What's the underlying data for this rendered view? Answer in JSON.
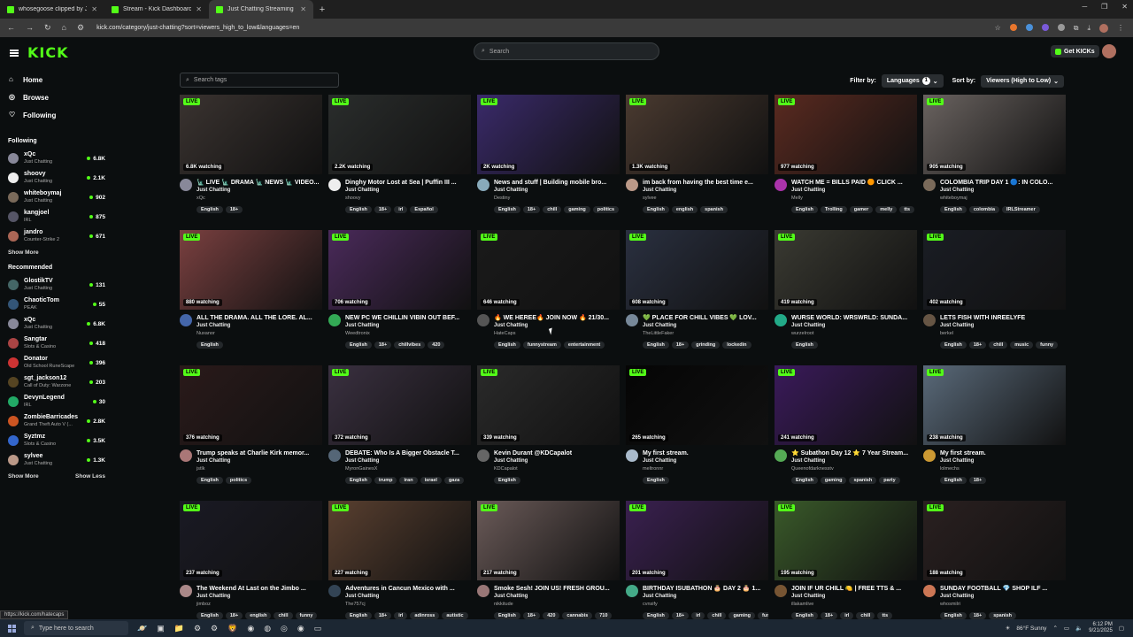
{
  "browser": {
    "tabs": [
      {
        "title": "whosegoose clipped by JagerR"
      },
      {
        "title": "Stream - Kick Dashboard"
      },
      {
        "title": "Just Chatting Streaming - Live"
      }
    ],
    "url": "kick.com/category/just-chatting?sort=viewers_high_to_low&languages=en",
    "status_url": "https://kick.com/hatecaps"
  },
  "app": {
    "logo": "KICK",
    "search_placeholder": "Search",
    "get_kicks": "Get KICKs",
    "accent": "#53fc18"
  },
  "sidebar": {
    "nav": [
      {
        "label": "Home",
        "icon": "home-icon"
      },
      {
        "label": "Browse",
        "icon": "compass-icon"
      },
      {
        "label": "Following",
        "icon": "heart-icon"
      }
    ],
    "following_title": "Following",
    "following": [
      {
        "name": "xQc",
        "category": "Just Chatting",
        "viewers": "6.8K",
        "color": "#889"
      },
      {
        "name": "shoovy",
        "category": "Just Chatting",
        "viewers": "2.1K",
        "color": "#eee"
      },
      {
        "name": "whiteboymaj",
        "category": "Just Chatting",
        "viewers": "902",
        "color": "#7a6a5a"
      },
      {
        "name": "kangjoel",
        "category": "IRL",
        "viewers": "875",
        "color": "#556"
      },
      {
        "name": "jandro",
        "category": "Counter-Strike 2",
        "viewers": "671",
        "color": "#a65"
      }
    ],
    "show_more_1": "Show More",
    "recommended_title": "Recommended",
    "recommended": [
      {
        "name": "GlostikTV",
        "category": "Just Chatting",
        "viewers": "131",
        "color": "#466"
      },
      {
        "name": "ChaoticTom",
        "category": "PEAK",
        "viewers": "55",
        "color": "#357"
      },
      {
        "name": "xQc",
        "category": "Just Chatting",
        "viewers": "6.8K",
        "color": "#889"
      },
      {
        "name": "Sangtar",
        "category": "Slots & Casino",
        "viewers": "418",
        "color": "#a44"
      },
      {
        "name": "Donator",
        "category": "Old School RuneScape",
        "viewers": "396",
        "color": "#c33"
      },
      {
        "name": "sgt_jackson12",
        "category": "Call of Duty: Warzone",
        "viewers": "203",
        "color": "#542"
      },
      {
        "name": "DevynLegend",
        "category": "IRL",
        "viewers": "30",
        "color": "#2a6"
      },
      {
        "name": "ZombieBarricades",
        "category": "Grand Theft Auto V (...",
        "viewers": "2.8K",
        "color": "#c52"
      },
      {
        "name": "Syztmz",
        "category": "Slots & Casino",
        "viewers": "3.5K",
        "color": "#36c"
      },
      {
        "name": "sylvee",
        "category": "Just Chatting",
        "viewers": "1.3K",
        "color": "#b98"
      }
    ],
    "show_more_2": "Show More",
    "show_less": "Show Less"
  },
  "filters": {
    "tag_search_placeholder": "Search tags",
    "filter_label": "Filter by:",
    "languages_label": "Languages",
    "languages_count": "1",
    "sort_label": "Sort by:",
    "sort_value": "Viewers (High to Low)"
  },
  "streams": [
    {
      "title": "🗽 LIVE 🗽 DRAMA 🗽 NEWS 🗽 VIDEO...",
      "category": "Just Chatting",
      "user": "xQc",
      "viewers": "6.8K watching",
      "tags": [
        "English",
        "18+"
      ],
      "thumb": "#3a3330",
      "avatar": "#889"
    },
    {
      "title": "Dinghy Motor Lost at Sea | Puffin III ...",
      "category": "Just Chatting",
      "user": "shoovy",
      "viewers": "2.2K watching",
      "tags": [
        "English",
        "18+",
        "irl",
        "Español"
      ],
      "thumb": "#2a2d2c",
      "avatar": "#eee"
    },
    {
      "title": "News and stuff | Building mobile bro...",
      "category": "Just Chatting",
      "user": "Destiny",
      "viewers": "2K watching",
      "tags": [
        "English",
        "18+",
        "chill",
        "gaming",
        "politics"
      ],
      "thumb": "#3a2a6a",
      "avatar": "#8ab"
    },
    {
      "title": "im back from having the best time e...",
      "category": "Just Chatting",
      "user": "sylvee",
      "viewers": "1.3K watching",
      "tags": [
        "English",
        "english",
        "spanish"
      ],
      "thumb": "#4a3a30",
      "avatar": "#b98"
    },
    {
      "title": "WATCH ME = BILLS PAID 🟠 CLICK ...",
      "category": "Just Chatting",
      "user": "Melly",
      "viewers": "977 watching",
      "tags": [
        "English",
        "Trolling",
        "gamer",
        "melly",
        "tts"
      ],
      "thumb": "#5a2a20",
      "avatar": "#a3a"
    },
    {
      "title": "COLOMBIA TRIP DAY 1 🔵: IN COLO...",
      "category": "Just Chatting",
      "user": "whiteboymaj",
      "viewers": "905 watching",
      "tags": [
        "English",
        "colombia",
        "IRLStreamer"
      ],
      "thumb": "#6a6360",
      "avatar": "#7a6a5a"
    },
    {
      "title": "ALL THE DRAMA. ALL THE LORE. AL...",
      "category": "Just Chatting",
      "user": "Nuxanor",
      "viewers": "880 watching",
      "tags": [
        "English"
      ],
      "thumb": "#7a4040",
      "avatar": "#46a"
    },
    {
      "title": "NEW PC WE CHILLIN VIBIN OUT BEF...",
      "category": "Just Chatting",
      "user": "Weedtronix",
      "viewers": "706 watching",
      "tags": [
        "English",
        "18+",
        "chillvibes",
        "420"
      ],
      "thumb": "#4a2a5a",
      "avatar": "#3a5"
    },
    {
      "title": "🔥 WE HEREE🔥 JOIN NOW 🔥 21/30...",
      "category": "Just Chatting",
      "user": "HateCaps",
      "viewers": "646 watching",
      "tags": [
        "English",
        "funnystream",
        "entertainment"
      ],
      "thumb": "#1a1a1a",
      "avatar": "#555"
    },
    {
      "title": "💚 PLACE FOR CHILL VIBES 💚 LOV...",
      "category": "Just Chatting",
      "user": "TheLittleFaker",
      "viewers": "608 watching",
      "tags": [
        "English",
        "18+",
        "grinding",
        "lockedin"
      ],
      "thumb": "#2a3040",
      "avatar": "#789"
    },
    {
      "title": "WURSE WORLD: WRSWRLD: SUNDA...",
      "category": "Just Chatting",
      "user": "wurzelroot",
      "viewers": "419 watching",
      "tags": [
        "English"
      ],
      "thumb": "#3a3a32",
      "avatar": "#2a8"
    },
    {
      "title": "LETS FISH WITH INREELYFE",
      "category": "Just Chatting",
      "user": "berkel",
      "viewers": "402 watching",
      "tags": [
        "English",
        "18+",
        "chill",
        "music",
        "funny"
      ],
      "thumb": "#1a1d24",
      "avatar": "#654"
    },
    {
      "title": "Trump speaks at Charlie Kirk memor...",
      "category": "Just Chatting",
      "user": "jstlk",
      "viewers": "376 watching",
      "tags": [
        "English",
        "politics"
      ],
      "thumb": "#2a1a1a",
      "avatar": "#a77"
    },
    {
      "title": "DEBATE: Who Is A Bigger Obstacle T...",
      "category": "Just Chatting",
      "user": "MyronGainesX",
      "viewers": "372 watching",
      "tags": [
        "English",
        "trump",
        "iran",
        "israel",
        "gaza"
      ],
      "thumb": "#3a3040",
      "avatar": "#567"
    },
    {
      "title": "Kevin Durant @KDCapalot",
      "category": "Just Chatting",
      "user": "KDCapalot",
      "viewers": "339 watching",
      "tags": [
        "English"
      ],
      "thumb": "#2a2a2a",
      "avatar": "#666"
    },
    {
      "title": "My first stream.",
      "category": "Just Chatting",
      "user": "meltronnr",
      "viewers": "265 watching",
      "tags": [
        "English"
      ],
      "thumb": "#050505",
      "avatar": "#abc"
    },
    {
      "title": "⭐ Subathon Day 12 ⭐ 7 Year Stream...",
      "category": "Just Chatting",
      "user": "Queenofdarknesstv",
      "viewers": "241 watching",
      "tags": [
        "English",
        "gaming",
        "spanish",
        "party"
      ],
      "thumb": "#3a1a5a",
      "avatar": "#5a5"
    },
    {
      "title": "My first stream.",
      "category": "Just Chatting",
      "user": "lolmechs",
      "viewers": "238 watching",
      "tags": [
        "English",
        "18+"
      ],
      "thumb": "#5a6a7a",
      "avatar": "#c93"
    },
    {
      "title": "The Weekend At Last on the Jimbo ...",
      "category": "Just Chatting",
      "user": "jimboz",
      "viewers": "237 watching",
      "tags": [
        "English",
        "18+",
        "english",
        "chill",
        "funny"
      ],
      "thumb": "#1a1a24",
      "avatar": "#a88"
    },
    {
      "title": "Adventures in Cancun Mexico with ...",
      "category": "Just Chatting",
      "user": "The757cj",
      "viewers": "227 watching",
      "tags": [
        "English",
        "18+",
        "irl",
        "adinross",
        "autistic"
      ],
      "thumb": "#5a4030",
      "avatar": "#345"
    },
    {
      "title": "Smoke Sesh! JOIN US! FRESH GROU...",
      "category": "Just Chatting",
      "user": "nikkitude",
      "viewers": "217 watching",
      "tags": [
        "English",
        "18+",
        "420",
        "cannabis",
        "710"
      ],
      "thumb": "#6a5a58",
      "avatar": "#977"
    },
    {
      "title": "BIRTHDAY ISUBATHON 🎂 DAY 2 🎂 1...",
      "category": "Just Chatting",
      "user": "cvnsify",
      "viewers": "201 watching",
      "tags": [
        "English",
        "18+",
        "irl",
        "chill",
        "gaming",
        "funny"
      ],
      "thumb": "#3a2050",
      "avatar": "#4a8"
    },
    {
      "title": "JOIN IF UR CHILL 🍋 | FREE TTS & ...",
      "category": "Just Chatting",
      "user": "illakamlive",
      "viewers": "195 watching",
      "tags": [
        "English",
        "18+",
        "irl",
        "chill",
        "tts"
      ],
      "thumb": "#3a5a2a",
      "avatar": "#753"
    },
    {
      "title": "SUNDAY FOOTBALL 💎 SHOP ILF ...",
      "category": "Just Chatting",
      "user": "whosmilri",
      "viewers": "188 watching",
      "tags": [
        "English",
        "18+",
        "spanish"
      ],
      "thumb": "#2a2020",
      "avatar": "#c75"
    }
  ],
  "taskbar": {
    "search_placeholder": "Type here to search",
    "weather": "86°F  Sunny",
    "time": "6:12 PM",
    "date": "9/21/2025"
  }
}
